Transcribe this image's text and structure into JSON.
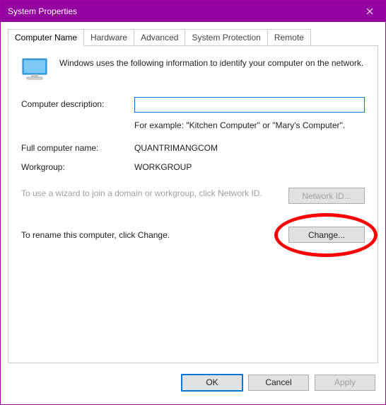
{
  "window": {
    "title": "System Properties"
  },
  "tabs": {
    "computer_name": "Computer Name",
    "hardware": "Hardware",
    "advanced": "Advanced",
    "system_protection": "System Protection",
    "remote": "Remote"
  },
  "intro": {
    "text": "Windows uses the following information to identify your computer on the network."
  },
  "fields": {
    "description_label": "Computer description:",
    "description_value": "",
    "example_text": "For example: \"Kitchen Computer\" or \"Mary's Computer\".",
    "fullname_label": "Full computer name:",
    "fullname_value": "QUANTRIMANGCOM",
    "workgroup_label": "Workgroup:",
    "workgroup_value": "WORKGROUP"
  },
  "wizard": {
    "text": "To use a wizard to join a domain or workgroup, click Network ID.",
    "button": "Network ID..."
  },
  "rename": {
    "text": "To rename this computer, click Change.",
    "button": "Change..."
  },
  "footer": {
    "ok": "OK",
    "cancel": "Cancel",
    "apply": "Apply"
  }
}
